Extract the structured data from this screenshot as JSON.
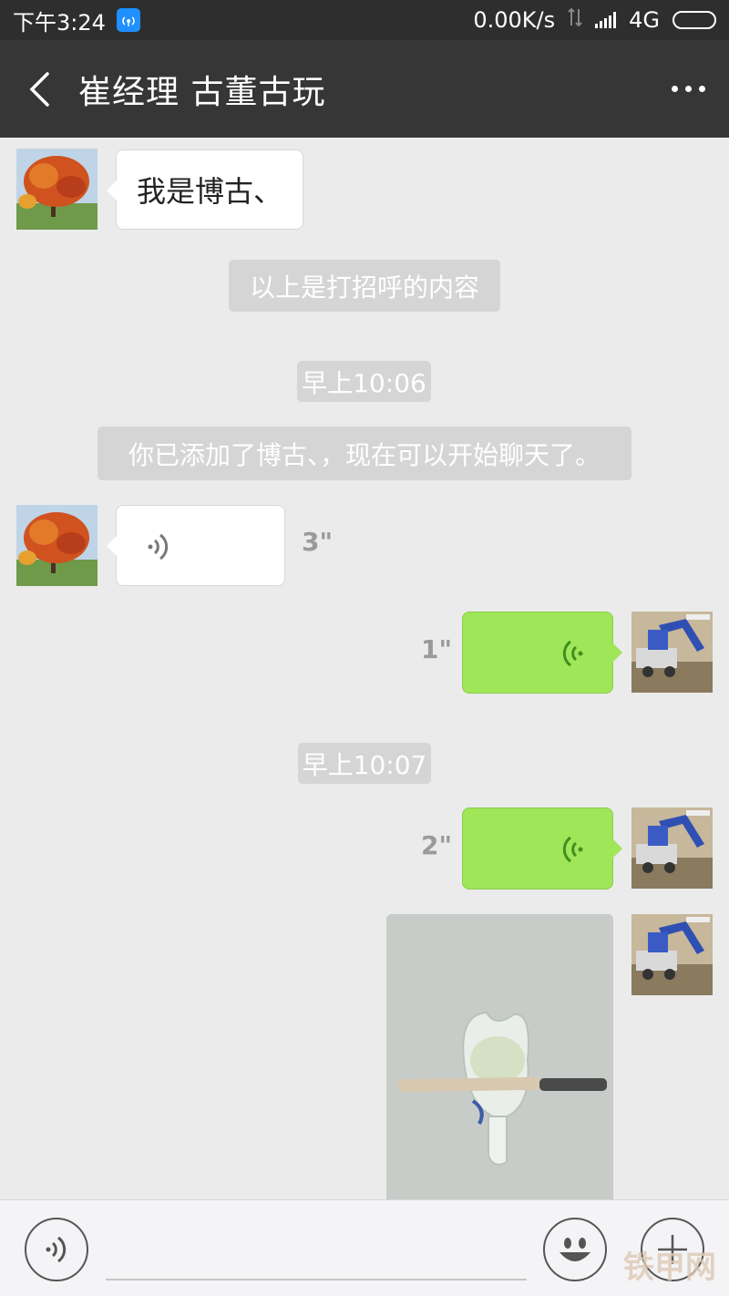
{
  "status_bar": {
    "time": "下午3:24",
    "network_speed": "0.00K/s",
    "network_type": "4G",
    "battery_color": "#f39a1a"
  },
  "nav": {
    "title": "崔经理 古董古玩",
    "back_icon": "chevron-left-icon",
    "more_icon": "more-dots-icon"
  },
  "messages": {
    "m1_text": "我是博古、",
    "sys1": "以上是打招呼的内容",
    "time1": "早上10:06",
    "sys2": "你已添加了博古、，现在可以开始聊天了。",
    "voice_in_duration": "3\"",
    "voice_out1_duration": "1\"",
    "time2": "早上10:07",
    "voice_out2_duration": "2\""
  },
  "colors": {
    "outgoing_bubble": "#9fe658",
    "incoming_bubble": "#ffffff",
    "nav_bg": "#363636",
    "chat_bg": "#ebebeb"
  },
  "input_bar": {
    "voice_icon": "voice-mode-icon",
    "emoji_icon": "emoji-icon",
    "plus_icon": "plus-icon"
  },
  "watermark": "铁甲网"
}
